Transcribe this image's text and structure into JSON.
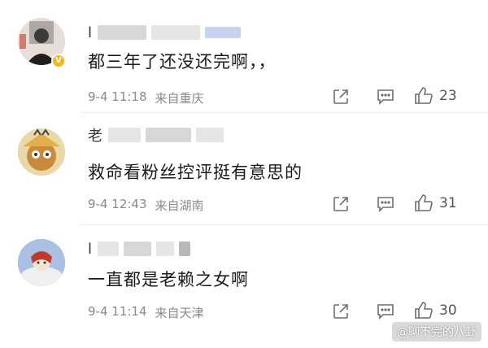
{
  "comments": [
    {
      "username": "l",
      "text": "都三年了还没还完啊，，",
      "date": "9-4",
      "time": "11:18",
      "location": "来自重庆",
      "likes": "23"
    },
    {
      "username": "老",
      "text": "救命看粉丝控评挺有意思的",
      "date": "9-4",
      "time": "12:43",
      "location": "来自湖南",
      "likes": "31"
    },
    {
      "username": "l",
      "text": "一直都是老赖之女啊",
      "date": "9-4",
      "time": "11:14",
      "location": "来自天津",
      "likes": "30"
    }
  ],
  "watermark": "@聊不完的八卦",
  "colors": {
    "meta": "#8a8a8a",
    "badge": "#f3b71f",
    "icon": "#6e6e6e"
  },
  "icons": [
    "share-icon",
    "comment-icon",
    "like-icon",
    "verified-badge-icon"
  ]
}
